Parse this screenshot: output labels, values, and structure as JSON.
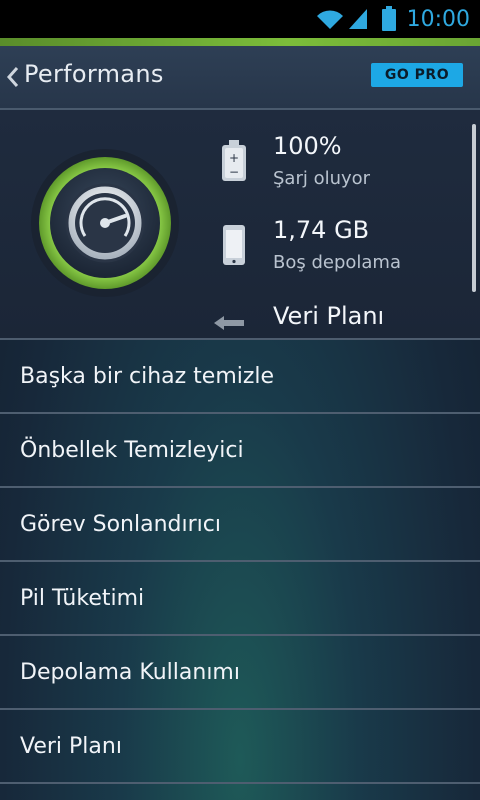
{
  "status_bar": {
    "time": "10:00",
    "icons": [
      "wifi-icon",
      "signal-icon",
      "battery-icon"
    ]
  },
  "header": {
    "title": "Performans",
    "go_pro_label": "GO PRO",
    "back_icon": "chevron-left-icon"
  },
  "performance": {
    "gauge_icon": "speedometer-icon",
    "stats": [
      {
        "icon": "battery-icon",
        "value": "100%",
        "label": "Şarj oluyor"
      },
      {
        "icon": "phone-icon",
        "value": "1,74 GB",
        "label": "Boş depolama"
      },
      {
        "icon": "data-arrow-icon",
        "value": "Veri Planı",
        "label": ""
      }
    ]
  },
  "menu": {
    "items": [
      {
        "label": "Başka bir cihaz temizle"
      },
      {
        "label": "Önbellek Temizleyici"
      },
      {
        "label": "Görev Sonlandırıcı"
      },
      {
        "label": "Pil Tüketimi"
      },
      {
        "label": "Depolama Kullanımı"
      },
      {
        "label": "Veri Planı"
      }
    ]
  },
  "colors": {
    "accent_green": "#7cbd3a",
    "go_pro_blue": "#1da8e5",
    "status_blue": "#2fa9e0"
  }
}
